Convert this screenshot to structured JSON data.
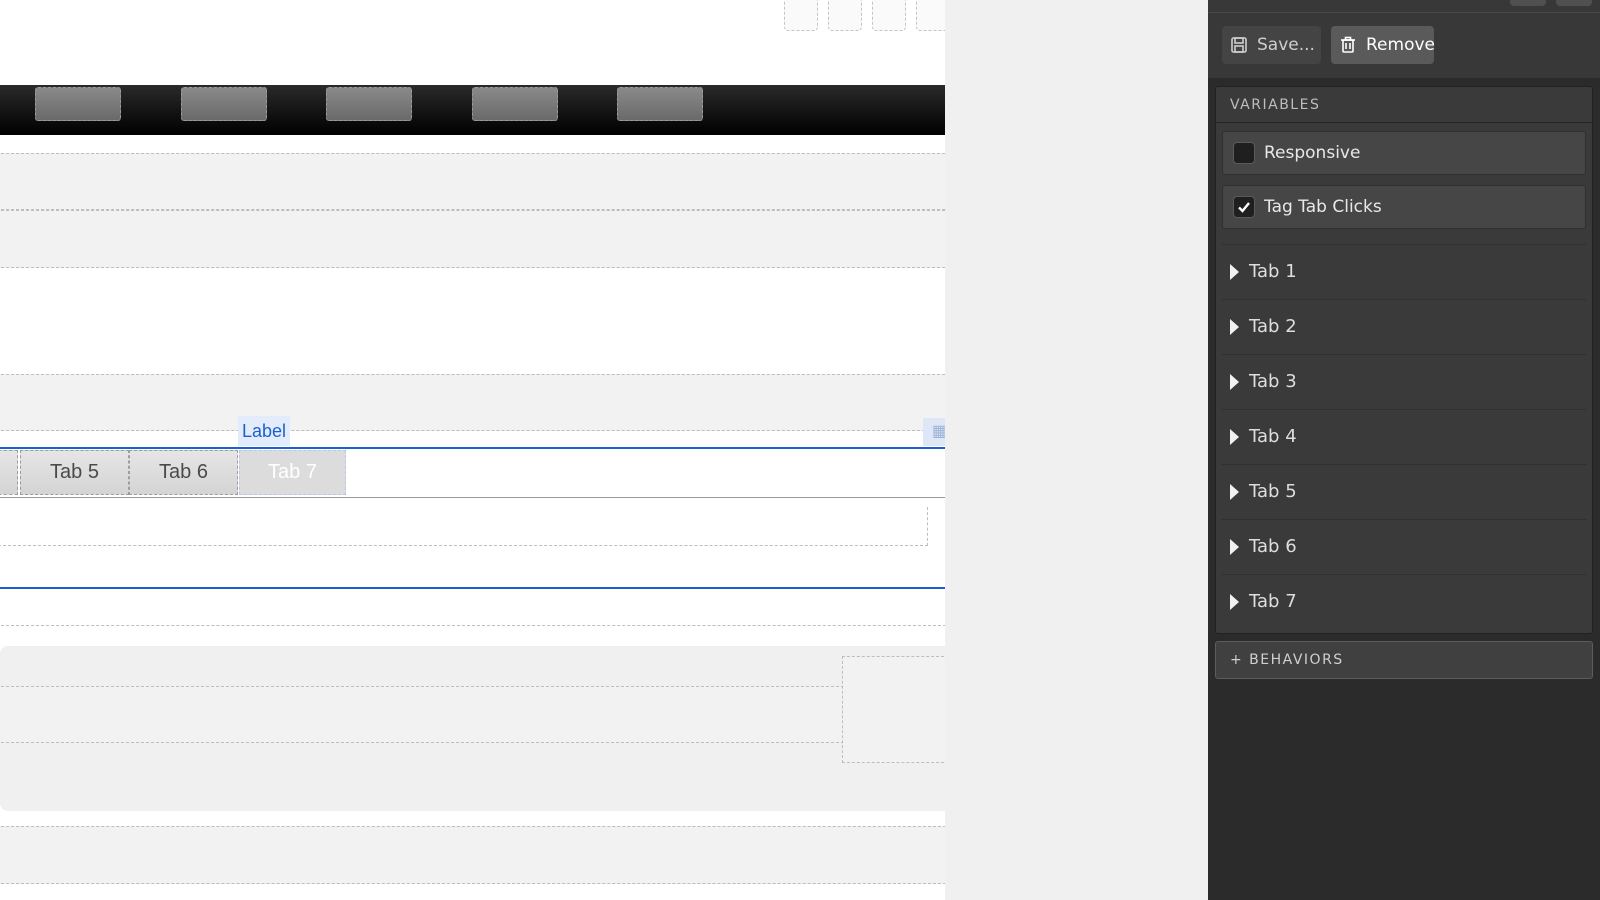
{
  "canvas": {
    "tab_widget": {
      "label_tag": "Label",
      "tabs": [
        "Tab 5",
        "Tab 6",
        "Tab 7"
      ],
      "active_tab": "Tab 7"
    }
  },
  "inspector": {
    "actions": {
      "save_label": "Save...",
      "remove_label": "Remove"
    },
    "variables": {
      "header": "VARIABLES",
      "options": [
        {
          "label": "Responsive",
          "checked": false
        },
        {
          "label": "Tag Tab Clicks",
          "checked": true
        }
      ],
      "tabs": [
        "Tab 1",
        "Tab 2",
        "Tab 3",
        "Tab 4",
        "Tab 5",
        "Tab 6",
        "Tab 7"
      ]
    },
    "behaviors_label": "+ BEHAVIORS"
  },
  "colors": {
    "selection": "#1c5fcf",
    "inspector_bg": "#2b2b2b",
    "nav_bar": "#000000"
  }
}
